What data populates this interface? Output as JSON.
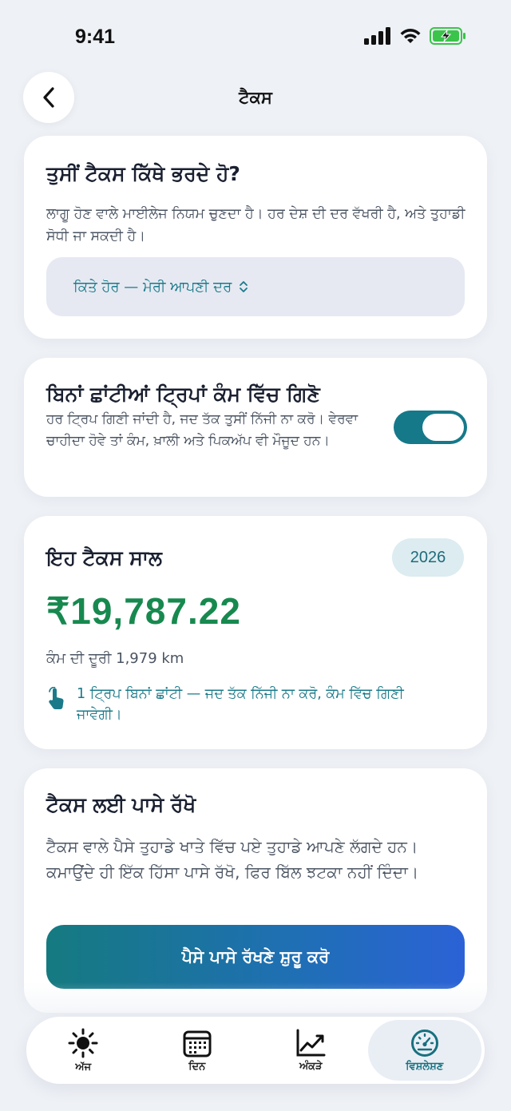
{
  "status_bar": {
    "time": "9:41"
  },
  "header": {
    "title": "ਟੈਕਸ"
  },
  "where_card": {
    "title": "ਤੁਸੀਂ ਟੈਕਸ ਕਿੱਥੇ ਭਰਦੇ ਹੋ?",
    "description": "ਲਾਗੂ ਹੋਣ ਵਾਲੇ ਮਾਈਲੇਜ ਨਿਯਮ ਚੁਣਦਾ ਹੈ। ਹਰ ਦੇਸ਼ ਦੀ ਦਰ ਵੱਖਰੀ ਹੈ, ਅਤੇ ਤੁਹਾਡੀ ਸੋਧੀ ਜਾ ਸਕਦੀ ਹੈ।",
    "selected_option": "ਕਿਤੇ ਹੋਰ — ਮੇਰੀ ਆਪਣੀ ਦਰ"
  },
  "count_card": {
    "title": "ਬਿਨਾਂ ਛਾਂਟੀਆਂ ਟ੍ਰਿਪਾਂ ਕੰਮ ਵਿੱਚ ਗਿਣੋ",
    "description": "ਹਰ ਟ੍ਰਿਪ ਗਿਣੀ ਜਾਂਦੀ ਹੈ, ਜਦ ਤੱਕ ਤੁਸੀਂ ਨਿੱਜੀ ਨਾ ਕਰੋ। ਵੇਰਵਾ ਚਾਹੀਦਾ ਹੋਵੇ ਤਾਂ ਕੰਮ, ਖ਼ਾਲੀ ਅਤੇ ਪਿਕਅੱਪ ਵੀ ਮੌਜੂਦ ਹਨ।",
    "toggle_on": true
  },
  "tax_year_card": {
    "title": "ਇਹ ਟੈਕਸ ਸਾਲ",
    "year": "2026",
    "amount": "₹19,787.22",
    "distance": "ਕੰਮ ਦੀ ਦੂਰੀ 1,979 km",
    "unsorted_note": "1 ਟ੍ਰਿਪ ਬਿਨਾਂ ਛਾਂਟੀ — ਜਦ ਤੱਕ ਨਿੱਜੀ ਨਾ ਕਰੋ, ਕੰਮ ਵਿੱਚ ਗਿਣੀ ਜਾਵੇਗੀ।"
  },
  "set_aside_card": {
    "title": "ਟੈਕਸ ਲਈ ਪਾਸੇ ਰੱਖੋ",
    "description": "ਟੈਕਸ ਵਾਲੇ ਪੈਸੇ ਤੁਹਾਡੇ ਖਾਤੇ ਵਿੱਚ ਪਏ ਤੁਹਾਡੇ ਆਪਣੇ ਲੱਗਦੇ ਹਨ। ਕਮਾਉਂਦੇ ਹੀ ਇੱਕ ਹਿੱਸਾ ਪਾਸੇ ਰੱਖੋ, ਫਿਰ ਬਿੱਲ ਝਟਕਾ ਨਹੀਂ ਦਿੰਦਾ।",
    "button": "ਪੈਸੇ ਪਾਸੇ ਰੱਖਣੇ ਸ਼ੁਰੂ ਕਰੋ"
  },
  "tab_bar": {
    "tabs": [
      {
        "label": "ਅੱਜ",
        "icon": "sun-icon"
      },
      {
        "label": "ਦਿਨ",
        "icon": "calendar-icon"
      },
      {
        "label": "ਅੰਕੜੇ",
        "icon": "chart-line-icon"
      },
      {
        "label": "ਵਿਸ਼ਲੇਸ਼ਣ",
        "icon": "speedometer-icon"
      }
    ],
    "active_index": 3
  },
  "colors": {
    "accent": "#15798a",
    "amount_green": "#17894f",
    "background": "#eef1f6"
  }
}
